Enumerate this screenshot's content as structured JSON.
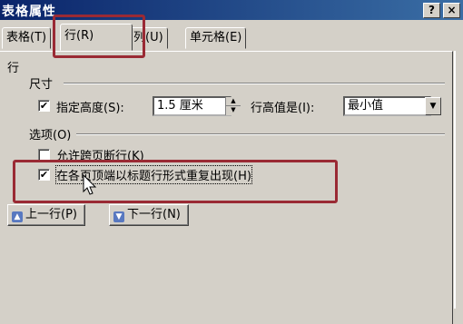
{
  "window": {
    "title": "表格属性",
    "help_btn": "?",
    "close_btn": "×"
  },
  "tabs": [
    {
      "label": "表格(T)",
      "active": false
    },
    {
      "label": "行(R)",
      "active": true
    },
    {
      "label": "列(U)",
      "active": false
    },
    {
      "label": "单元格(E)",
      "active": false
    }
  ],
  "row_section": {
    "heading": "行",
    "size_group": "尺寸",
    "specify_height_label": "指定高度(S):",
    "specify_height_checked": true,
    "height_value": "1.5 厘米",
    "row_height_is_label": "行高值是(I):",
    "row_height_is_value": "最小值",
    "options_group": "选项(O)",
    "allow_break_label": "允许跨页断行(K)",
    "allow_break_checked": false,
    "repeat_header_label": "在各页顶端以标题行形式重复出现(H)",
    "repeat_header_checked": true
  },
  "buttons": {
    "prev_row": "上一行(P)",
    "next_row": "下一行(N)"
  },
  "colors": {
    "highlight_box": "#9a2a34",
    "dialog_bg": "#d4d0c8",
    "titlebar": "#0a246a"
  }
}
